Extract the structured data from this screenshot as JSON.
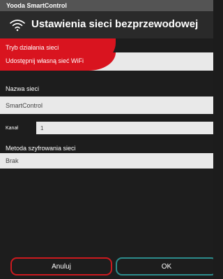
{
  "app": {
    "name": "Yooda SmartControl"
  },
  "header": {
    "title": "Ustawienia sieci bezprzewodowej",
    "icon": "wifi-icon"
  },
  "mode": {
    "label": "Tryb działania sieci",
    "value": "Udostępnij własną sieć WiFi"
  },
  "network_name": {
    "label": "Nazwa sieci",
    "value": "SmartControl"
  },
  "channel": {
    "label": "Kanał",
    "value": "1"
  },
  "encryption": {
    "label": "Metoda szyfrowania sieci",
    "value": "Brak"
  },
  "buttons": {
    "cancel": "Anuluj",
    "ok": "OK"
  },
  "colors": {
    "accent_red": "#d9141f",
    "accent_teal": "#2c8c8c",
    "background": "#1d1d1d",
    "field": "#e9e9e9"
  }
}
